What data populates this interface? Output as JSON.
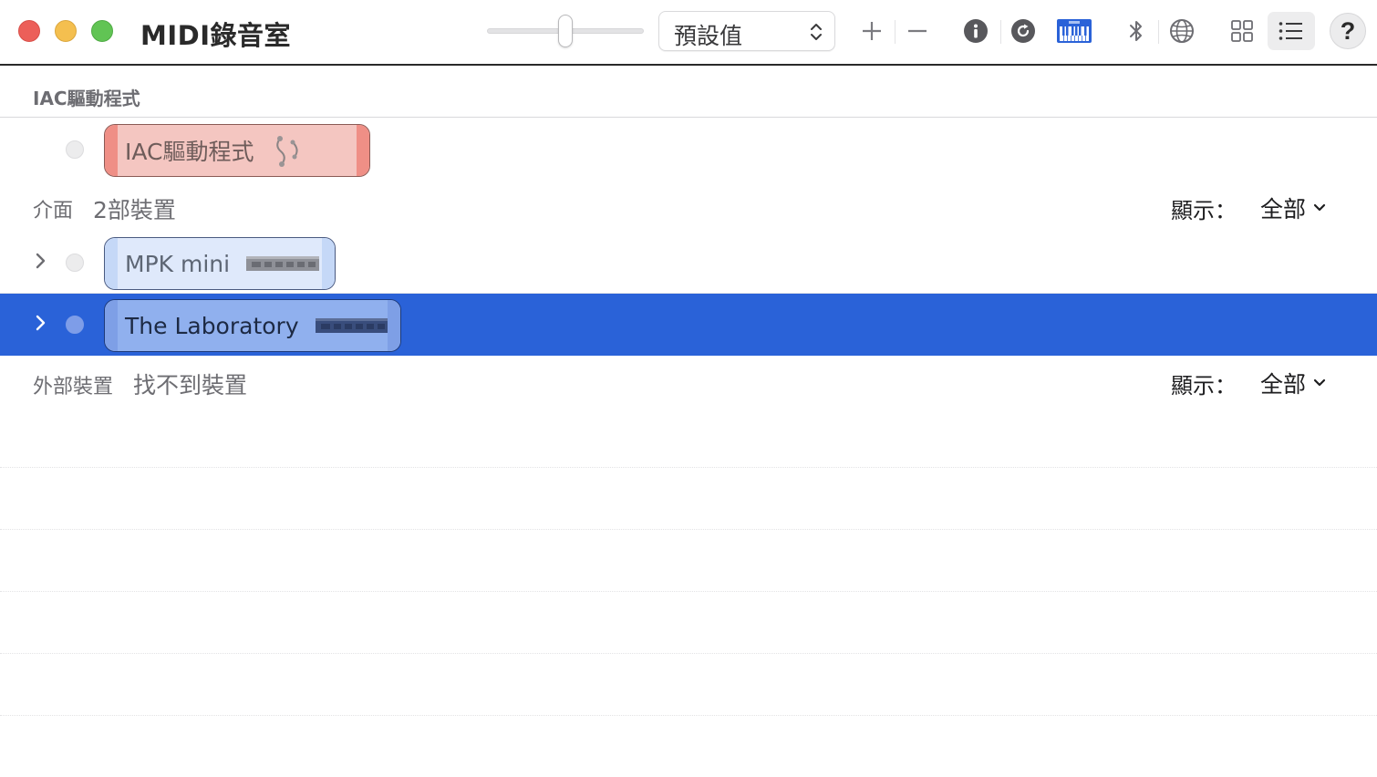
{
  "window": {
    "title": "MIDI錄音室"
  },
  "toolbar": {
    "zoom_slider_level": 0.5,
    "preset_label": "預設值",
    "icons": [
      "plus-icon",
      "minus-icon",
      "info-icon",
      "refresh-icon",
      "keyboard-icon",
      "bluetooth-icon",
      "network-icon",
      "grid-view-icon",
      "list-view-icon",
      "help-icon"
    ],
    "help_label": "?"
  },
  "colors": {
    "selection": "#2a62d8",
    "iac_chip": "#f4c6c1",
    "device_chip": "#dfe9fb",
    "keyboard_icon": "#2a62d8"
  },
  "sections": {
    "iac": {
      "header": "IAC驅動程式",
      "device": {
        "label": "IAC驅動程式",
        "icon": "midi-cable-icon"
      }
    },
    "interfaces": {
      "label": "介面",
      "count": "2部裝置",
      "show_label": "顯示：",
      "show_value": "全部",
      "devices": [
        {
          "label": "MPK mini",
          "selected": false
        },
        {
          "label": "The Laboratory",
          "selected": true
        }
      ]
    },
    "external": {
      "label": "外部裝置",
      "status": "找不到裝置",
      "show_label": "顯示：",
      "show_value": "全部"
    }
  }
}
